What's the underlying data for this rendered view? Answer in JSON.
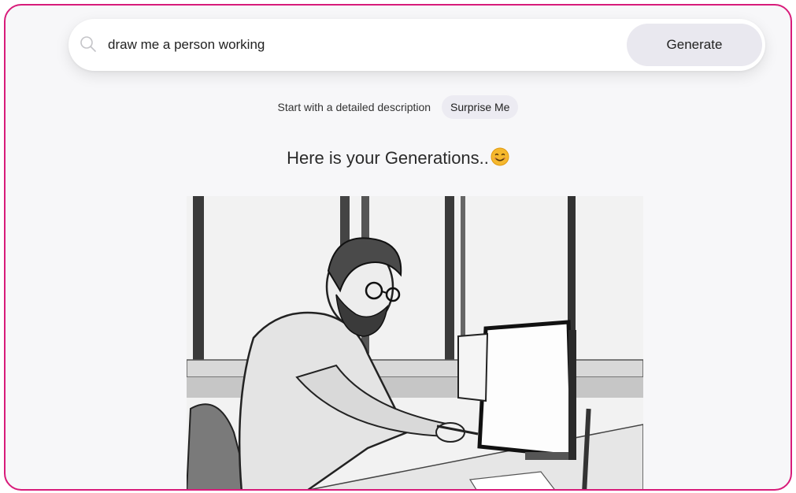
{
  "search": {
    "value": "draw me a person working",
    "generate_label": "Generate"
  },
  "hint": {
    "text": "Start with a detailed description",
    "surprise_label": "Surprise Me"
  },
  "result": {
    "heading": "Here is your Generations..",
    "emoji_icon": "smiling-face-icon"
  },
  "colors": {
    "frame_border": "#d81b7a",
    "button_bg": "#e9e8ef"
  }
}
